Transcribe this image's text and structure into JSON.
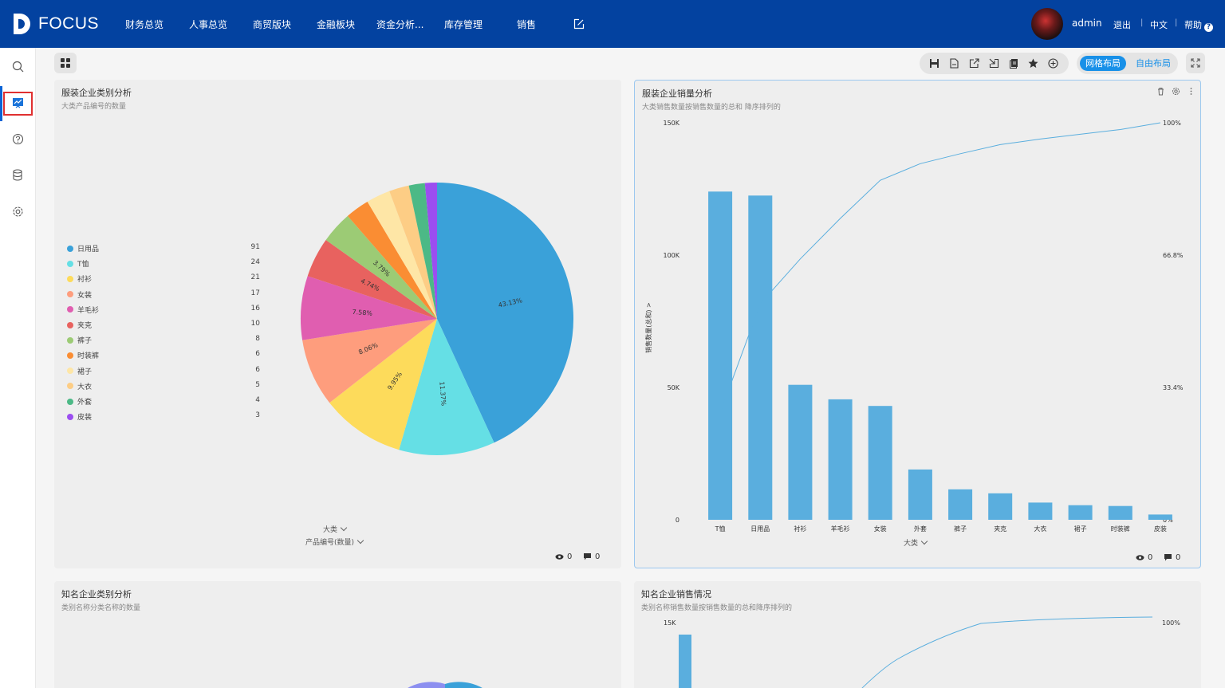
{
  "app": {
    "brand": "FOCUS",
    "user": "admin"
  },
  "nav": {
    "items": [
      "财务总览",
      "人事总览",
      "商贸版块",
      "金融板块",
      "资金分析...",
      "库存管理",
      "销售"
    ],
    "logout": "退出",
    "lang": "中文",
    "help": "帮助"
  },
  "toolbar": {
    "layout_grid": "网格布局",
    "layout_free": "自由布局"
  },
  "cards": {
    "pie1": {
      "title": "服装企业类别分析",
      "subtitle": "大类产品编号的数量",
      "dim": "大类",
      "measure": "产品编号(数量)",
      "views": "0",
      "comments": "0"
    },
    "bar1": {
      "title": "服装企业销量分析",
      "subtitle": "大类销售数量按销售数量的总和 降序排列的",
      "ylabel": "销售数量(总和)",
      "xlabel": "大类",
      "views": "0",
      "comments": "0"
    },
    "pie2": {
      "title": "知名企业类别分析",
      "subtitle": "类别名称分类名称的数量"
    },
    "bar2": {
      "title": "知名企业销售情况",
      "subtitle": "类别名称销售数量按销售数量的总和降序排列的",
      "ytick_top": "15K",
      "y2tick_top": "100%"
    }
  },
  "chart_data": [
    {
      "type": "pie",
      "title": "服装企业类别分析",
      "subtitle": "大类产品编号的数量",
      "categories": [
        "日用品",
        "T恤",
        "衬衫",
        "女装",
        "羊毛衫",
        "夹克",
        "裤子",
        "时装裤",
        "裙子",
        "大衣",
        "外套",
        "皮装"
      ],
      "values": [
        91,
        24,
        21,
        17,
        16,
        10,
        8,
        6,
        6,
        5,
        4,
        3
      ],
      "colors": [
        "#3aa1d9",
        "#65dfe5",
        "#fddb5b",
        "#fe9d7d",
        "#e05eb0",
        "#e8625f",
        "#9ccb75",
        "#fa8d33",
        "#fee6a6",
        "#fdcd85",
        "#4cb986",
        "#9b4ef0"
      ],
      "labels": [
        "43.13%",
        "11.37%",
        "9.95%",
        "8.06%",
        "7.58%",
        "4.74%",
        "3.79%"
      ],
      "legend": "left"
    },
    {
      "type": "bar",
      "title": "服装企业销量分析",
      "subtitle": "大类销售数量按销售数量的总和 降序排列的",
      "categories": [
        "T恤",
        "日用品",
        "衬衫",
        "羊毛衫",
        "女装",
        "外套",
        "裤子",
        "夹克",
        "大衣",
        "裙子",
        "时装裤",
        "皮装"
      ],
      "values": [
        124000,
        122500,
        51000,
        45500,
        43000,
        19000,
        11500,
        10000,
        6500,
        5500,
        5200,
        2000
      ],
      "cumulative_pct": [
        27,
        54.4,
        65.7,
        75.9,
        85.5,
        89.7,
        92.2,
        94.5,
        95.9,
        97.1,
        98.3,
        100
      ],
      "ylabel": "销售数量(总和)",
      "xlabel": "大类",
      "ylim": [
        0,
        150000
      ],
      "yticks": [
        "0",
        "50K",
        "100K",
        "150K"
      ],
      "y2ticks": [
        "0%",
        "33.4%",
        "66.8%",
        "100%"
      ],
      "color": "#5aaede",
      "line_color": "#5aaede"
    }
  ]
}
